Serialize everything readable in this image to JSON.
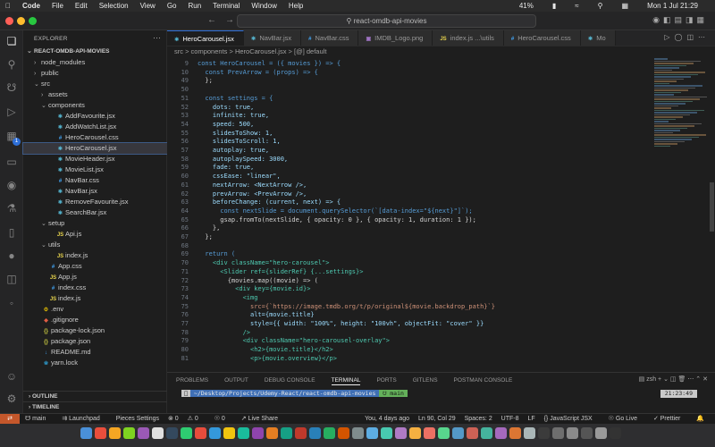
{
  "menubar": {
    "app": "Code",
    "items": [
      "File",
      "Edit",
      "Selection",
      "View",
      "Go",
      "Run",
      "Terminal",
      "Window",
      "Help"
    ],
    "battery": "41%",
    "datetime": "Mon 1 Jul  21:29"
  },
  "titlebar": {
    "command_center": "react-omdb-api-movies"
  },
  "sidebar": {
    "title": "EXPLORER",
    "project": "REACT-OMDB-API-MOVIES",
    "tree": [
      {
        "label": "node_modules",
        "type": "folder",
        "depth": 1,
        "open": false
      },
      {
        "label": "public",
        "type": "folder",
        "depth": 1,
        "open": false
      },
      {
        "label": "src",
        "type": "folder",
        "depth": 1,
        "open": true
      },
      {
        "label": "assets",
        "type": "folder",
        "depth": 2,
        "open": false
      },
      {
        "label": "components",
        "type": "folder",
        "depth": 2,
        "open": true
      },
      {
        "label": "AddFavourite.jsx",
        "type": "jsx",
        "depth": 3
      },
      {
        "label": "AddWatchList.jsx",
        "type": "jsx",
        "depth": 3
      },
      {
        "label": "HeroCarousel.css",
        "type": "css",
        "depth": 3
      },
      {
        "label": "HeroCarousel.jsx",
        "type": "jsx",
        "depth": 3,
        "selected": true
      },
      {
        "label": "MovieHeader.jsx",
        "type": "jsx",
        "depth": 3
      },
      {
        "label": "MovieList.jsx",
        "type": "jsx",
        "depth": 3
      },
      {
        "label": "NavBar.css",
        "type": "css",
        "depth": 3
      },
      {
        "label": "NavBar.jsx",
        "type": "jsx",
        "depth": 3
      },
      {
        "label": "RemoveFavourite.jsx",
        "type": "jsx",
        "depth": 3
      },
      {
        "label": "SearchBar.jsx",
        "type": "jsx",
        "depth": 3
      },
      {
        "label": "setup",
        "type": "folder",
        "depth": 2,
        "open": true
      },
      {
        "label": "Api.js",
        "type": "js",
        "depth": 3
      },
      {
        "label": "utils",
        "type": "folder",
        "depth": 2,
        "open": true
      },
      {
        "label": "index.js",
        "type": "js",
        "depth": 3
      },
      {
        "label": "App.css",
        "type": "css",
        "depth": 2
      },
      {
        "label": "App.js",
        "type": "js",
        "depth": 2
      },
      {
        "label": "index.css",
        "type": "css",
        "depth": 2
      },
      {
        "label": "index.js",
        "type": "js",
        "depth": 2
      },
      {
        "label": ".env",
        "type": "env",
        "depth": 1
      },
      {
        "label": ".gitignore",
        "type": "git",
        "depth": 1
      },
      {
        "label": "package-lock.json",
        "type": "json",
        "depth": 1
      },
      {
        "label": "package.json",
        "type": "json",
        "depth": 1
      },
      {
        "label": "README.md",
        "type": "md",
        "depth": 1
      },
      {
        "label": "yarn.lock",
        "type": "yarn",
        "depth": 1
      }
    ],
    "outline": "OUTLINE",
    "timeline": "TIMELINE"
  },
  "tabs": [
    {
      "label": "HeroCarousel.jsx",
      "type": "jsx",
      "active": true
    },
    {
      "label": "NavBar.jsx",
      "type": "jsx"
    },
    {
      "label": "NavBar.css",
      "type": "css"
    },
    {
      "label": "IMDB_Logo.png",
      "type": "png"
    },
    {
      "label": "index.js ...\\utils",
      "type": "js"
    },
    {
      "label": "HeroCarousel.css",
      "type": "css"
    },
    {
      "label": "Mo",
      "type": "jsx"
    }
  ],
  "breadcrumb": "src  >  components  >  HeroCarousel.jsx  >  [@] default",
  "code": [
    {
      "n": "9",
      "t": "const HeroCarousel = ({ movies }) => {",
      "cls": "kw"
    },
    {
      "n": "10",
      "t": "  const PrevArrow = (props) => {",
      "cls": "kw"
    },
    {
      "n": "49",
      "t": "  };",
      "cls": ""
    },
    {
      "n": "50",
      "t": "",
      "cls": ""
    },
    {
      "n": "51",
      "t": "  const settings = {",
      "cls": "kw"
    },
    {
      "n": "52",
      "t": "    dots: true,",
      "cls": "prop"
    },
    {
      "n": "53",
      "t": "    infinite: true,",
      "cls": "prop"
    },
    {
      "n": "54",
      "t": "    speed: 500,",
      "cls": "prop"
    },
    {
      "n": "55",
      "t": "    slidesToShow: 1,",
      "cls": "prop"
    },
    {
      "n": "56",
      "t": "    slidesToScroll: 1,",
      "cls": "prop"
    },
    {
      "n": "57",
      "t": "    autoplay: true,",
      "cls": "prop"
    },
    {
      "n": "58",
      "t": "    autoplaySpeed: 3000,",
      "cls": "prop"
    },
    {
      "n": "59",
      "t": "    fade: true,",
      "cls": "prop"
    },
    {
      "n": "60",
      "t": "    cssEase: \"linear\",",
      "cls": "prop"
    },
    {
      "n": "61",
      "t": "    nextArrow: <NextArrow />,",
      "cls": "prop"
    },
    {
      "n": "62",
      "t": "    prevArrow: <PrevArrow />,",
      "cls": "prop"
    },
    {
      "n": "63",
      "t": "    beforeChange: (current, next) => {",
      "cls": "prop"
    },
    {
      "n": "64",
      "t": "      const nextSlide = document.querySelector(`[data-index=\"${next}\"]`);",
      "cls": "kw"
    },
    {
      "n": "65",
      "t": "      gsap.fromTo(nextSlide, { opacity: 0 }, { opacity: 1, duration: 1 });",
      "cls": ""
    },
    {
      "n": "66",
      "t": "    },",
      "cls": ""
    },
    {
      "n": "67",
      "t": "  };",
      "cls": ""
    },
    {
      "n": "68",
      "t": "",
      "cls": ""
    },
    {
      "n": "69",
      "t": "  return (",
      "cls": "kw"
    },
    {
      "n": "70",
      "t": "    <div className=\"hero-carousel\">",
      "cls": "tag"
    },
    {
      "n": "71",
      "t": "      <Slider ref={sliderRef} {...settings}>",
      "cls": "tag"
    },
    {
      "n": "72",
      "t": "        {movies.map((movie) => (",
      "cls": ""
    },
    {
      "n": "73",
      "t": "          <div key={movie.id}>",
      "cls": "tag"
    },
    {
      "n": "74",
      "t": "            <img",
      "cls": "tag"
    },
    {
      "n": "75",
      "t": "              src={`https://image.tmdb.org/t/p/original${movie.backdrop_path}`}",
      "cls": "str"
    },
    {
      "n": "76",
      "t": "              alt={movie.title}",
      "cls": "prop"
    },
    {
      "n": "77",
      "t": "              style={{ width: \"100%\", height: \"100vh\", objectFit: \"cover\" }}",
      "cls": "prop"
    },
    {
      "n": "78",
      "t": "            />",
      "cls": "tag"
    },
    {
      "n": "79",
      "t": "            <div className=\"hero-carousel-overlay\">",
      "cls": "tag"
    },
    {
      "n": "80",
      "t": "              <h2>{movie.title}</h2>",
      "cls": "tag"
    },
    {
      "n": "81",
      "t": "              <p>{movie.overview}</p>",
      "cls": "tag"
    }
  ],
  "panel": {
    "tabs": [
      "PROBLEMS",
      "OUTPUT",
      "DEBUG CONSOLE",
      "TERMINAL",
      "PORTS",
      "GITLENS",
      "POSTMAN CONSOLE"
    ],
    "active_tab": "TERMINAL",
    "shell": "zsh",
    "prompt_path": "~/Desktop/Projects/Udemy-React/react-omdb-api-movies",
    "branch": "main",
    "time": "21:23:49"
  },
  "status": {
    "branch": "main",
    "launchpad": "Launchpad",
    "pieces": "Pieces Settings",
    "errors": "0",
    "warnings": "0",
    "ports": "0",
    "liveshare": "Live Share",
    "blame": "You, 4 days ago",
    "position": "Ln 90, Col 29",
    "spaces": "Spaces: 2",
    "encoding": "UTF-8",
    "eol": "LF",
    "language": "JavaScript JSX",
    "golive": "Go Live",
    "prettier": "Prettier"
  },
  "colors": {
    "keyword": "#569cd6",
    "function": "#dcdcaa",
    "string": "#ce9178",
    "property": "#9cdcfe",
    "tag": "#4ec9b0",
    "jsx": "#61dafb",
    "css": "#42a5f5",
    "js": "#e8d44d",
    "accent": "#2e6fd8"
  }
}
